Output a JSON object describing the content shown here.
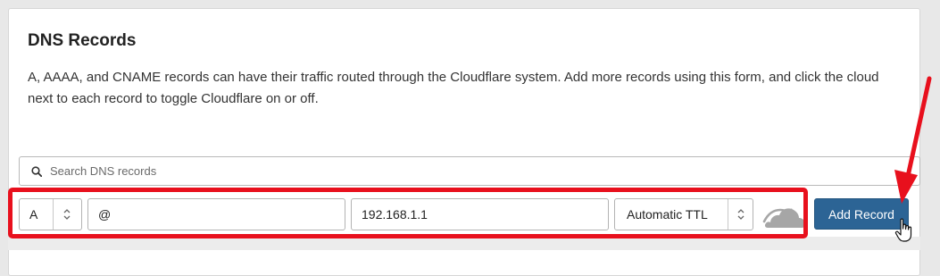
{
  "panel": {
    "title": "DNS Records",
    "description": "A, AAAA, and CNAME records can have their traffic routed through the Cloudflare system. Add more records using this form, and click the cloud next to each record to toggle Cloudflare on or off."
  },
  "search": {
    "placeholder": "Search DNS records",
    "icon": "search-icon"
  },
  "form": {
    "type_value": "A",
    "name_value": "@",
    "content_value": "192.168.1.1",
    "ttl_value": "Automatic TTL",
    "proxy_icon": "cloud-icon",
    "proxy_status": "off",
    "add_button_label": "Add Record"
  },
  "annotations": {
    "highlight_color": "#e8101d"
  },
  "colors": {
    "primary_button": "#2c6495",
    "cloud_off": "#a6a6a6"
  }
}
